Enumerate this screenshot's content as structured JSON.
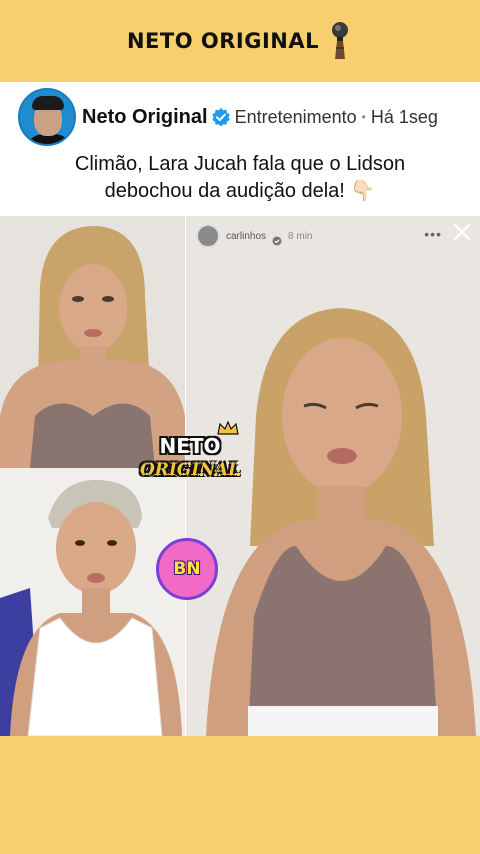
{
  "header": {
    "brand_title": "NETO ORIGINAL",
    "brand_icon": "microphone-icon",
    "background": "#f7cf6c"
  },
  "post": {
    "author": "Neto Original",
    "verified_icon": "verified-badge-icon",
    "category": "Entretenimento",
    "separator": "•",
    "timestamp": "Há 1seg",
    "headline_line1": "Climão, Lara Jucah fala que o Lidson",
    "headline_line2": "debochou da audição dela! 👇🏻"
  },
  "media": {
    "story_user": "carlinhos",
    "story_time": "8 min",
    "story_more": "•••",
    "watermark_line1": "NETO",
    "watermark_line2": "ORIGINAL",
    "badge_text": "BN"
  },
  "colors": {
    "accent_yellow": "#f7cf6c",
    "verified_blue": "#1d9bf0"
  }
}
